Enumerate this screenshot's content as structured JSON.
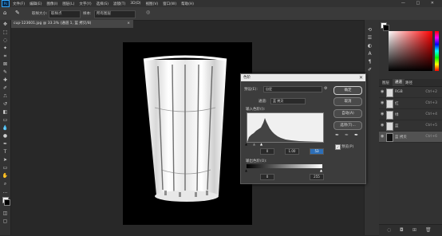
{
  "menu": {
    "logo": "Ps",
    "items": [
      "文件(F)",
      "编辑(E)",
      "图像(I)",
      "图层(L)",
      "文字(Y)",
      "选择(S)",
      "滤镜(T)",
      "3D(D)",
      "视图(V)",
      "窗口(W)",
      "帮助(H)"
    ],
    "window_controls": "— □ ✕"
  },
  "options": {
    "sample_label": "取样大小:",
    "sample_value": "取样点",
    "sample2_label": "样本:",
    "sample2_value": "所有图层",
    "ring_label": "显示取样环"
  },
  "document": {
    "tab_title": "cup-123601.jpg @ 33.3% (通道 1, 蓝 拷贝/8)",
    "tab_close": "×"
  },
  "dialog": {
    "title": "色阶",
    "close": "✕",
    "preset_label": "预设(E):",
    "preset_value": "自定",
    "channel_label": "通道:",
    "channel_value": "蓝 拷贝",
    "input_label": "输入色阶(I):",
    "input_black": "0",
    "input_gamma": "1.00",
    "input_white": "53",
    "output_label": "输出色阶(O):",
    "output_black": "0",
    "output_white": "255",
    "ok": "确定",
    "cancel": "取消",
    "auto": "自动(A)",
    "options": "选项(T)...",
    "preview": "预览(P)",
    "preview_checked": true
  },
  "panels": {
    "tabs": [
      "图层",
      "通道",
      "路径"
    ],
    "channels": [
      {
        "name": "RGB",
        "key": "Ctrl+2",
        "visible": true
      },
      {
        "name": "红",
        "key": "Ctrl+3",
        "visible": true
      },
      {
        "name": "绿",
        "key": "Ctrl+4",
        "visible": true
      },
      {
        "name": "蓝",
        "key": "Ctrl+5",
        "visible": true
      },
      {
        "name": "蓝 拷贝",
        "key": "Ctrl+6",
        "visible": true
      }
    ]
  },
  "colors": {
    "accent": "#31a8ff",
    "bg": "#282828",
    "panel": "#323232"
  }
}
